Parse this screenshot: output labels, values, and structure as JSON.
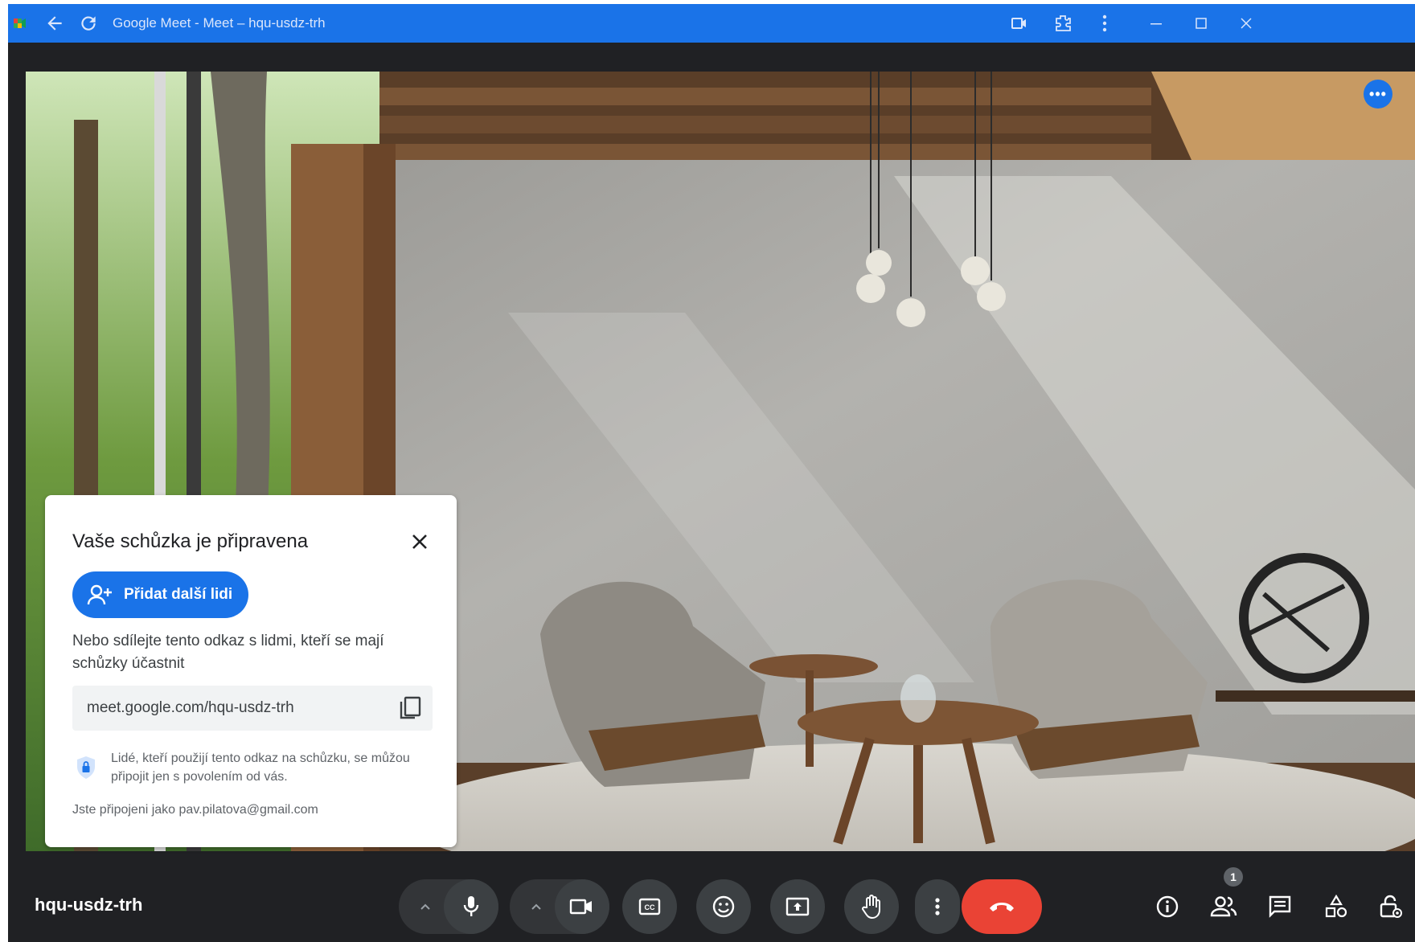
{
  "window": {
    "title": "Google Meet - Meet – hqu-usdz-trh"
  },
  "dialog": {
    "title": "Vaše schůzka je připravena",
    "add_button_label": "Přidat další lidi",
    "share_text": "Nebo sdílejte tento odkaz s lidmi, kteří se mají schůzky účastnit",
    "meeting_link": "meet.google.com/hqu-usdz-trh",
    "permission_text": "Lidé, kteří použijí tento odkaz na schůzku, se můžou připojit jen s povolením od vás.",
    "joined_as_text": "Jste připojeni jako pav.pilatova@gmail.com"
  },
  "bottom_bar": {
    "meeting_code": "hqu-usdz-trh",
    "participants_badge": "1",
    "controls": [
      "mic-icon",
      "camera-icon",
      "captions-icon",
      "emoji-icon",
      "present-icon",
      "raise-hand-icon",
      "more-options-icon",
      "hang-up-icon"
    ],
    "side_controls": [
      "info-icon",
      "people-icon",
      "chat-icon",
      "activities-icon",
      "host-controls-icon"
    ]
  },
  "colors": {
    "title_bar": "#1a73e8",
    "background": "#202124",
    "control": "#3c4043",
    "hangup": "#ea4335",
    "accent": "#1a73e8"
  }
}
